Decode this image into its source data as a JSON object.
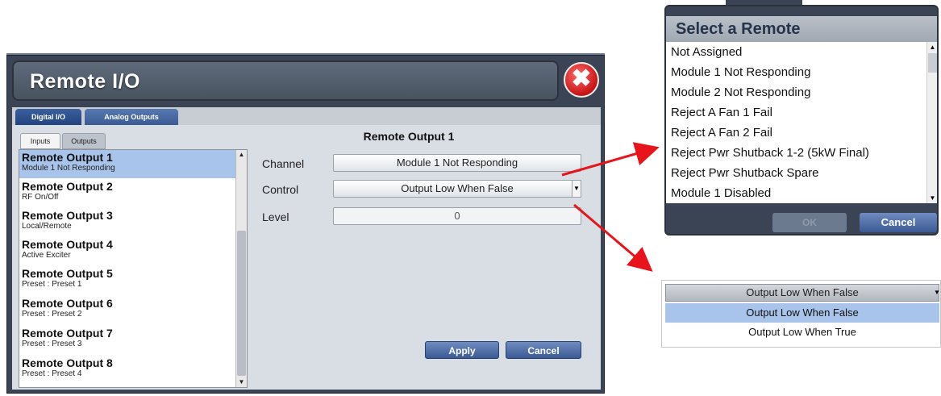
{
  "window": {
    "title": "Remote I/O",
    "close_glyph": "✖"
  },
  "tabs": [
    {
      "label": "Digital I/O"
    },
    {
      "label": "Analog Outputs"
    }
  ],
  "subtabs": [
    {
      "label": "Inputs"
    },
    {
      "label": "Outputs"
    }
  ],
  "list": {
    "rows": [
      {
        "title": "Remote Output 1",
        "subtitle": "Module 1 Not Responding"
      },
      {
        "title": "Remote Output 2",
        "subtitle": "RF On/Off"
      },
      {
        "title": "Remote Output 3",
        "subtitle": "Local/Remote"
      },
      {
        "title": "Remote Output 4",
        "subtitle": "Active Exciter"
      },
      {
        "title": "Remote Output 5",
        "subtitle": "Preset : Preset 1"
      },
      {
        "title": "Remote Output 6",
        "subtitle": "Preset : Preset 2"
      },
      {
        "title": "Remote Output 7",
        "subtitle": "Preset : Preset 3"
      },
      {
        "title": "Remote Output 8",
        "subtitle": "Preset : Preset 4"
      }
    ]
  },
  "detail": {
    "title": "Remote Output 1",
    "channel_label": "Channel",
    "channel_value": "Module 1 Not Responding",
    "control_label": "Control",
    "control_value": "Output Low When False",
    "level_label": "Level",
    "level_value": "0",
    "apply_label": "Apply",
    "cancel_label": "Cancel"
  },
  "remote_dialog": {
    "title": "Select a Remote",
    "items": [
      "Not Assigned",
      "Module 1 Not Responding",
      "Module 2 Not Responding",
      "Reject A Fan 1 Fail",
      "Reject A Fan 2 Fail",
      "Reject Pwr Shutback 1-2 (5kW Final)",
      "Reject Pwr Shutback Spare",
      "Module 1 Disabled"
    ],
    "ok_label": "OK",
    "cancel_label": "Cancel"
  },
  "dropdown": {
    "current": "Output Low When False",
    "options": [
      "Output Low When False",
      "Output Low When True"
    ]
  },
  "glyphs": {
    "up": "▲",
    "down": "▼"
  },
  "colors": {
    "arrow": "#e8141b",
    "selection": "#a9c4ea",
    "button": "#3b5a94"
  }
}
